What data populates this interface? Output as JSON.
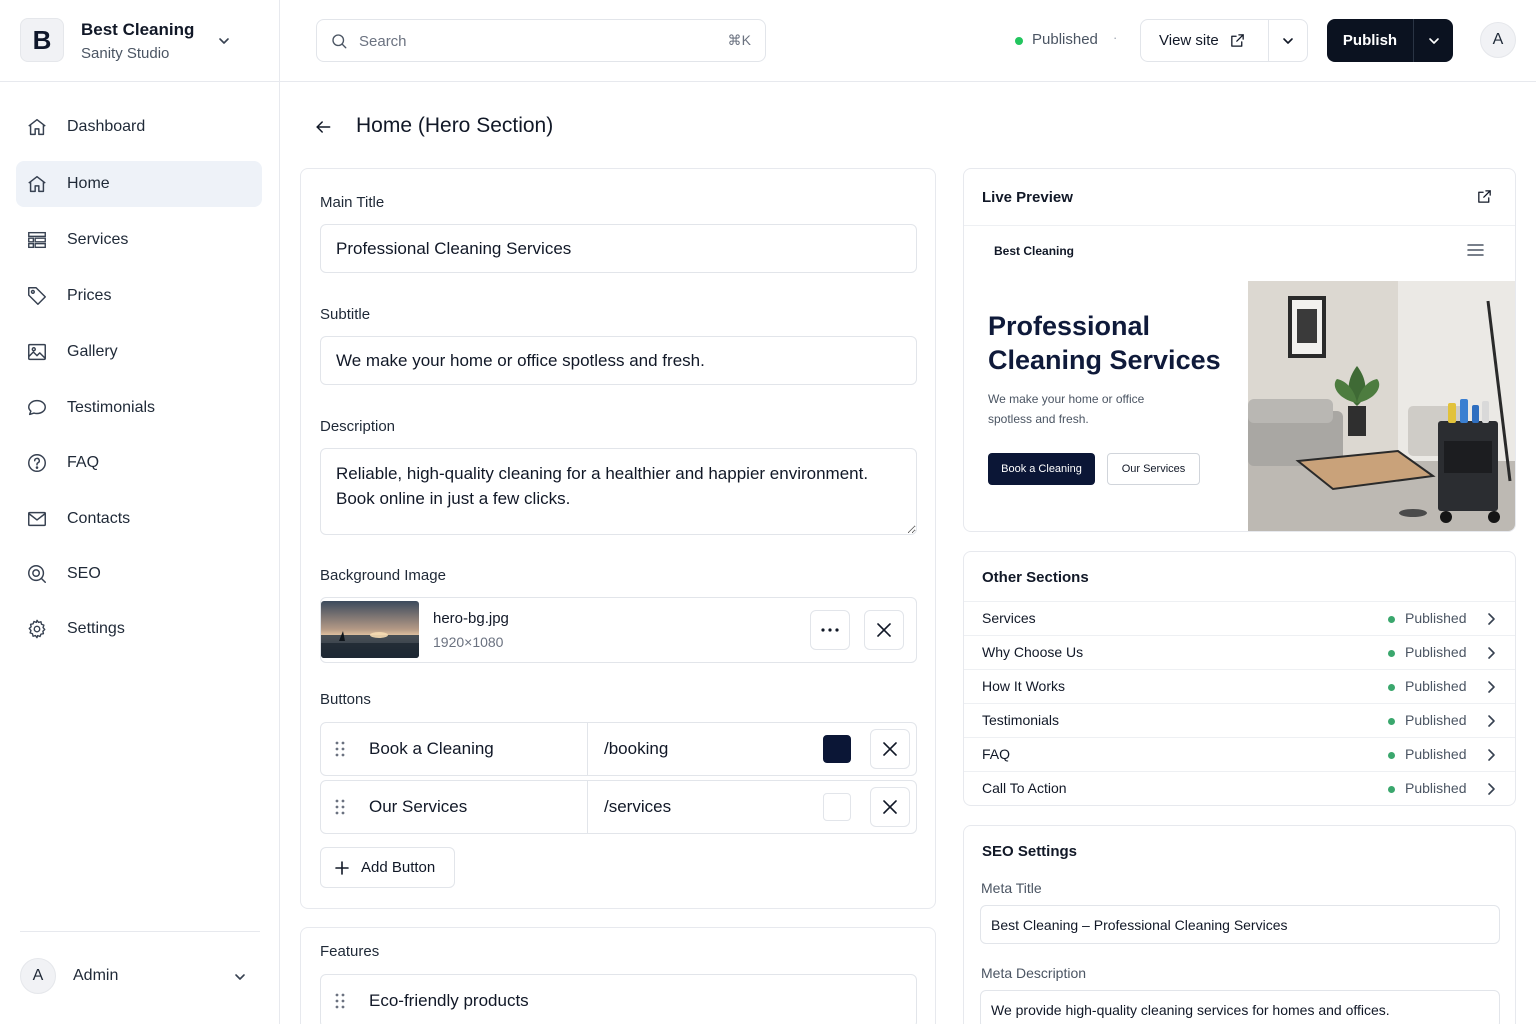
{
  "brand": {
    "logo_letter": "B",
    "name": "Best Cleaning",
    "subtitle": "Sanity Studio"
  },
  "sidebar": {
    "items": [
      {
        "label": "Dashboard",
        "icon": "home-icon"
      },
      {
        "label": "Home",
        "icon": "home-icon",
        "active": true
      },
      {
        "label": "Services",
        "icon": "services-icon"
      },
      {
        "label": "Prices",
        "icon": "tag-icon"
      },
      {
        "label": "Gallery",
        "icon": "image-icon"
      },
      {
        "label": "Testimonials",
        "icon": "chat-bubble-icon"
      },
      {
        "label": "FAQ",
        "icon": "question-circle-icon"
      },
      {
        "label": "Contacts",
        "icon": "mail-icon"
      },
      {
        "label": "SEO",
        "icon": "search-icon"
      },
      {
        "label": "Settings",
        "icon": "gear-icon"
      }
    ],
    "user": {
      "avatar_letter": "A",
      "name": "Admin"
    }
  },
  "topbar": {
    "search_placeholder": "Search",
    "search_shortcut": "⌘K",
    "status": "Published",
    "status_separator": "·",
    "view_site_label": "View site",
    "publish_label": "Publish",
    "user_avatar_letter": "A"
  },
  "page": {
    "title": "Home (Hero Section)"
  },
  "form": {
    "main_title": {
      "label": "Main Title",
      "value": "Professional Cleaning Services"
    },
    "subtitle": {
      "label": "Subtitle",
      "value": "We make your home or office spotless and fresh."
    },
    "description": {
      "label": "Description",
      "value": "Reliable, high-quality cleaning for a healthier and happier environment. Book online in just a few clicks."
    },
    "background_image": {
      "label": "Background Image",
      "filename": "hero-bg.jpg",
      "dimensions": "1920×1080"
    },
    "buttons": {
      "label": "Buttons",
      "items": [
        {
          "label": "Book a Cleaning",
          "url": "/booking",
          "color": "#0b1636"
        },
        {
          "label": "Our Services",
          "url": "/services",
          "color": "#ffffff"
        }
      ],
      "add_label": "Add Button"
    },
    "features": {
      "label": "Features",
      "items": [
        "Eco-friendly products"
      ]
    }
  },
  "preview": {
    "title": "Live Preview",
    "brand": "Best Cleaning",
    "heading": "Professional Cleaning Services",
    "subtitle": "We make your home or office spotless and fresh.",
    "primary_button": "Book a Cleaning",
    "secondary_button": "Our Services"
  },
  "other_sections": {
    "title": "Other Sections",
    "items": [
      {
        "name": "Services",
        "status": "Published"
      },
      {
        "name": "Why Choose Us",
        "status": "Published"
      },
      {
        "name": "How It Works",
        "status": "Published"
      },
      {
        "name": "Testimonials",
        "status": "Published"
      },
      {
        "name": "FAQ",
        "status": "Published"
      },
      {
        "name": "Call To Action",
        "status": "Published"
      }
    ]
  },
  "seo": {
    "title": "SEO Settings",
    "meta_title_label": "Meta Title",
    "meta_title_value": "Best Cleaning – Professional Cleaning Services",
    "meta_description_label": "Meta Description",
    "meta_description_value": "We provide high-quality cleaning services for homes and offices."
  },
  "colors": {
    "accent": "#0b1220",
    "status_green": "#22c55e",
    "active_nav_bg": "#eef2f8"
  }
}
